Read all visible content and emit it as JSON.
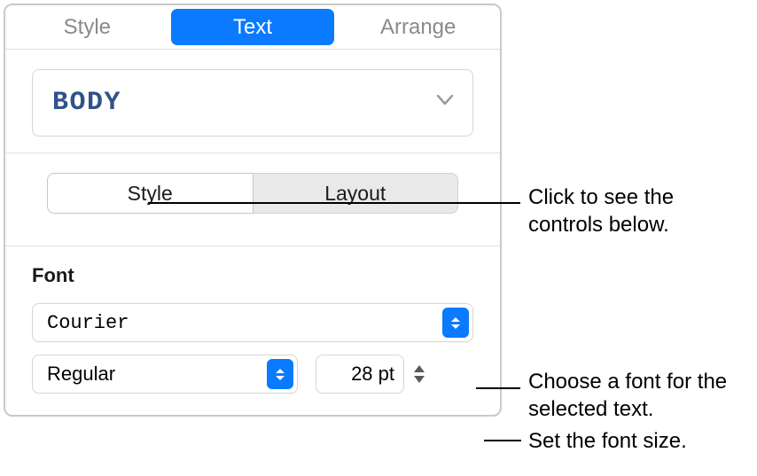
{
  "tabs": {
    "style": "Style",
    "text": "Text",
    "arrange": "Arrange"
  },
  "paragraph_style": "BODY",
  "segments": {
    "style": "Style",
    "layout": "Layout"
  },
  "font": {
    "heading": "Font",
    "family": "Courier",
    "weight": "Regular",
    "size": "28 pt"
  },
  "callouts": {
    "segmented": "Click to see the controls below.",
    "font_family": "Choose a font for the selected text.",
    "font_size": "Set the font size."
  }
}
